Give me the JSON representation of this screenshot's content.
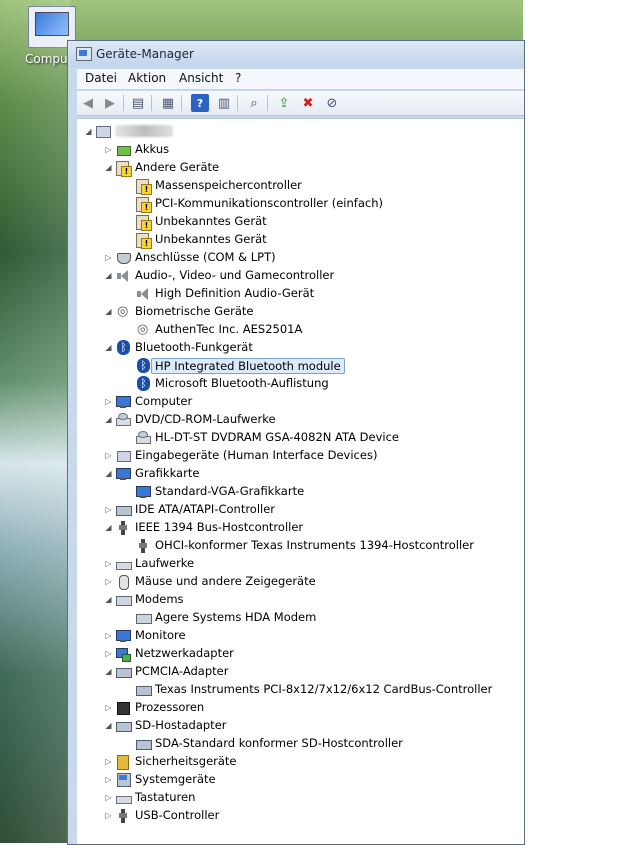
{
  "desktop": {
    "icon_label": "Compu"
  },
  "window": {
    "title": "Geräte-Manager"
  },
  "menu": [
    "Datei",
    "Aktion",
    "Ansicht",
    "?"
  ],
  "toolbar": [
    {
      "icon": "back-arrow-icon"
    },
    {
      "icon": "forward-arrow-icon"
    },
    {
      "icon": "console-tree-icon"
    },
    {
      "icon": "properties-icon"
    },
    {
      "icon": "help-icon"
    },
    {
      "icon": "view-icon"
    },
    {
      "icon": "scan-hardware-icon"
    },
    {
      "icon": "update-driver-icon"
    },
    {
      "icon": "uninstall-icon"
    },
    {
      "icon": "disable-icon"
    }
  ],
  "tree": [
    {
      "level": 0,
      "label": "",
      "icon": "computer-root",
      "expanded": true,
      "redacted": true
    },
    {
      "level": 1,
      "label": "Akkus",
      "icon": "battery",
      "expanded": false
    },
    {
      "level": 1,
      "label": "Andere Geräte",
      "icon": "warn",
      "expanded": true
    },
    {
      "level": 2,
      "label": "Massenspeichercontroller",
      "icon": "warn"
    },
    {
      "level": 2,
      "label": "PCI-Kommunikationscontroller (einfach)",
      "icon": "warn"
    },
    {
      "level": 2,
      "label": "Unbekanntes Gerät",
      "icon": "warn"
    },
    {
      "level": 2,
      "label": "Unbekanntes Gerät",
      "icon": "warn"
    },
    {
      "level": 1,
      "label": "Anschlüsse (COM & LPT)",
      "icon": "ports",
      "expanded": false
    },
    {
      "level": 1,
      "label": "Audio-, Video- und Gamecontroller",
      "icon": "speaker",
      "expanded": true
    },
    {
      "level": 2,
      "label": "High Definition Audio-Gerät",
      "icon": "speaker"
    },
    {
      "level": 1,
      "label": "Biometrische Geräte",
      "icon": "fingerprint",
      "expanded": true
    },
    {
      "level": 2,
      "label": "AuthenTec Inc. AES2501A",
      "icon": "fingerprint"
    },
    {
      "level": 1,
      "label": "Bluetooth-Funkgerät",
      "icon": "bluetooth",
      "expanded": true
    },
    {
      "level": 2,
      "label": "HP Integrated Bluetooth module",
      "icon": "bluetooth",
      "selected": true
    },
    {
      "level": 2,
      "label": "Microsoft Bluetooth-Auflistung",
      "icon": "bluetooth"
    },
    {
      "level": 1,
      "label": "Computer",
      "icon": "monitor",
      "expanded": false
    },
    {
      "level": 1,
      "label": "DVD/CD-ROM-Laufwerke",
      "icon": "cdrom",
      "expanded": true
    },
    {
      "level": 2,
      "label": "HL-DT-ST DVDRAM GSA-4082N ATA Device",
      "icon": "cdrom"
    },
    {
      "level": 1,
      "label": "Eingabegeräte (Human Interface Devices)",
      "icon": "device",
      "expanded": false
    },
    {
      "level": 1,
      "label": "Grafikkarte",
      "icon": "monitor",
      "expanded": true
    },
    {
      "level": 2,
      "label": "Standard-VGA-Grafikkarte",
      "icon": "monitor"
    },
    {
      "level": 1,
      "label": "IDE ATA/ATAPI-Controller",
      "icon": "card",
      "expanded": false
    },
    {
      "level": 1,
      "label": "IEEE 1394 Bus-Hostcontroller",
      "icon": "usb",
      "expanded": true
    },
    {
      "level": 2,
      "label": "OHCI-konformer Texas Instruments 1394-Hostcontroller",
      "icon": "usb"
    },
    {
      "level": 1,
      "label": "Laufwerke",
      "icon": "keyboard",
      "expanded": false
    },
    {
      "level": 1,
      "label": "Mäuse und andere Zeigegeräte",
      "icon": "mouse",
      "expanded": false
    },
    {
      "level": 1,
      "label": "Modems",
      "icon": "modem",
      "expanded": true
    },
    {
      "level": 2,
      "label": "Agere Systems HDA Modem",
      "icon": "modem"
    },
    {
      "level": 1,
      "label": "Monitore",
      "icon": "monitor",
      "expanded": false
    },
    {
      "level": 1,
      "label": "Netzwerkadapter",
      "icon": "network",
      "expanded": false
    },
    {
      "level": 1,
      "label": "PCMCIA-Adapter",
      "icon": "card",
      "expanded": true
    },
    {
      "level": 2,
      "label": "Texas Instruments PCI-8x12/7x12/6x12 CardBus-Controller",
      "icon": "card"
    },
    {
      "level": 1,
      "label": "Prozessoren",
      "icon": "cpu",
      "expanded": false
    },
    {
      "level": 1,
      "label": "SD-Hostadapter",
      "icon": "card",
      "expanded": true
    },
    {
      "level": 2,
      "label": "SDA-Standard konformer SD-Hostcontroller",
      "icon": "card"
    },
    {
      "level": 1,
      "label": "Sicherheitsgeräte",
      "icon": "security",
      "expanded": false
    },
    {
      "level": 1,
      "label": "Systemgeräte",
      "icon": "computer",
      "expanded": false
    },
    {
      "level": 1,
      "label": "Tastaturen",
      "icon": "keyboard",
      "expanded": false
    },
    {
      "level": 1,
      "label": "USB-Controller",
      "icon": "usb",
      "expanded": false
    }
  ]
}
